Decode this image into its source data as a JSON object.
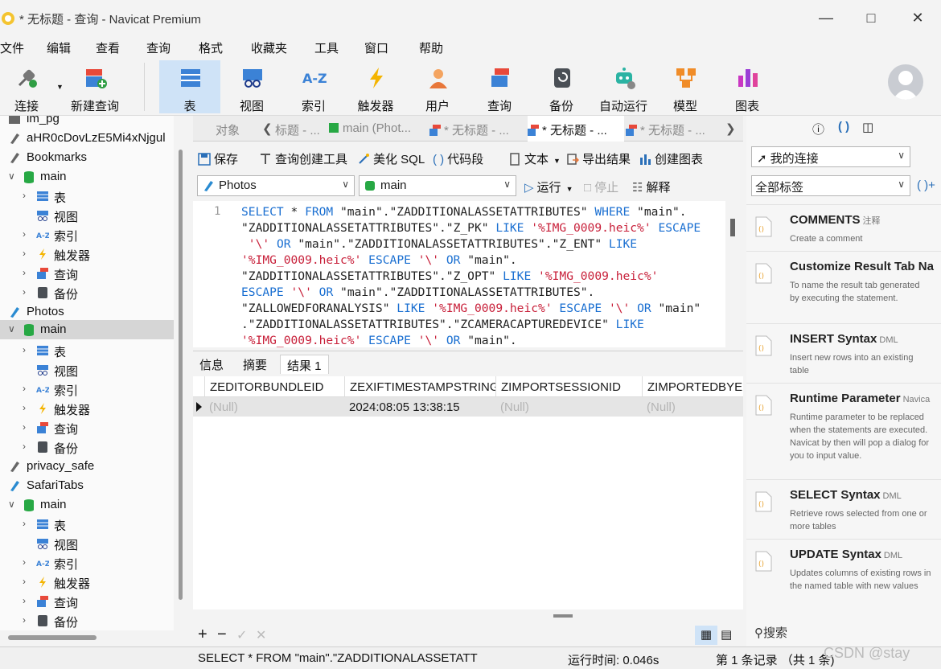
{
  "window": {
    "title": "* 无标题 - 查询 - Navicat Premium"
  },
  "menu": [
    "文件",
    "编辑",
    "查看",
    "查询",
    "格式",
    "收藏夹",
    "工具",
    "窗口",
    "帮助"
  ],
  "toolbar": {
    "connect": "连接",
    "new_query": "新建查询",
    "table": "表",
    "view": "视图",
    "index": "索引",
    "trigger": "触发器",
    "user": "用户",
    "query": "查询",
    "backup": "备份",
    "automation": "自动运行",
    "model": "模型",
    "chart": "图表"
  },
  "sidebar": {
    "im_pg": "im_pg",
    "conn2": "aHR0cDovLzE5Mi4xNjgul",
    "bookmarks": "Bookmarks",
    "photos": "Photos",
    "privacy": "privacy_safe",
    "safaritabs": "SafariTabs",
    "main": "main",
    "table": "表",
    "view": "视图",
    "index": "索引",
    "trigger": "触发器",
    "query": "查询",
    "backup": "备份"
  },
  "tabs": {
    "objects": "对象",
    "t1": "标题 - ...",
    "t2": "main (Phot...",
    "t3": "* 无标题 - ...",
    "t4": "* 无标题 - ...",
    "t5": "* 无标题 - ..."
  },
  "query_toolbar": {
    "save": "保存",
    "builder": "查询创建工具",
    "beautify": "美化 SQL",
    "snippet": "代码段",
    "text": "文本",
    "export": "导出结果",
    "create_chart": "创建图表"
  },
  "selectors": {
    "connection": "Photos",
    "database": "main",
    "run": "运行",
    "stop": "停止",
    "explain": "解释"
  },
  "editor": {
    "line_number": "1",
    "lines": [
      [
        [
          "kw",
          "SELECT"
        ],
        [
          "t",
          " * "
        ],
        [
          "kw",
          "FROM"
        ],
        [
          "t",
          " \"main\".\"ZADDITIONALASSETATTRIBUTES\" "
        ],
        [
          "kw",
          "WHERE"
        ],
        [
          "t",
          " \"main\"."
        ]
      ],
      [
        [
          "t",
          "\"ZADDITIONALASSETATTRIBUTES\".\"Z_PK\" "
        ],
        [
          "kw",
          "LIKE"
        ],
        [
          "t",
          " "
        ],
        [
          "str",
          "'%IMG_0009.heic%'"
        ],
        [
          "t",
          " "
        ],
        [
          "kw",
          "ESCAPE"
        ]
      ],
      [
        [
          "t",
          " "
        ],
        [
          "str",
          "'\\'"
        ],
        [
          "t",
          " "
        ],
        [
          "kw",
          "OR"
        ],
        [
          "t",
          " \"main\".\"ZADDITIONALASSETATTRIBUTES\".\"Z_ENT\" "
        ],
        [
          "kw",
          "LIKE"
        ]
      ],
      [
        [
          "str",
          "'%IMG_0009.heic%'"
        ],
        [
          "t",
          " "
        ],
        [
          "kw",
          "ESCAPE"
        ],
        [
          "t",
          " "
        ],
        [
          "str",
          "'\\'"
        ],
        [
          "t",
          " "
        ],
        [
          "kw",
          "OR"
        ],
        [
          "t",
          " \"main\"."
        ]
      ],
      [
        [
          "t",
          "\"ZADDITIONALASSETATTRIBUTES\".\"Z_OPT\" "
        ],
        [
          "kw",
          "LIKE"
        ],
        [
          "t",
          " "
        ],
        [
          "str",
          "'%IMG_0009.heic%'"
        ]
      ],
      [
        [
          "kw",
          "ESCAPE"
        ],
        [
          "t",
          " "
        ],
        [
          "str",
          "'\\'"
        ],
        [
          "t",
          " "
        ],
        [
          "kw",
          "OR"
        ],
        [
          "t",
          " \"main\".\"ZADDITIONALASSETATTRIBUTES\"."
        ]
      ],
      [
        [
          "t",
          "\"ZALLOWEDFORANALYSIS\" "
        ],
        [
          "kw",
          "LIKE"
        ],
        [
          "t",
          " "
        ],
        [
          "str",
          "'%IMG_0009.heic%'"
        ],
        [
          "t",
          " "
        ],
        [
          "kw",
          "ESCAPE"
        ],
        [
          "t",
          " "
        ],
        [
          "str",
          "'\\'"
        ],
        [
          "t",
          " "
        ],
        [
          "kw",
          "OR"
        ],
        [
          "t",
          " \"main\""
        ]
      ],
      [
        [
          "t",
          ".\"ZADDITIONALASSETATTRIBUTES\".\"ZCAMERACAPTUREDEVICE\" "
        ],
        [
          "kw",
          "LIKE"
        ]
      ],
      [
        [
          "str",
          "'%IMG_0009.heic%'"
        ],
        [
          "t",
          " "
        ],
        [
          "kw",
          "ESCAPE"
        ],
        [
          "t",
          " "
        ],
        [
          "str",
          "'\\'"
        ],
        [
          "t",
          " "
        ],
        [
          "kw",
          "OR"
        ],
        [
          "t",
          " \"main\"."
        ]
      ]
    ]
  },
  "result_tabs": {
    "info": "信息",
    "summary": "摘要",
    "result": "结果 1"
  },
  "grid": {
    "columns": [
      "ZEDITORBUNDLEID",
      "ZEXIFTIMESTAMPSTRING",
      "ZIMPORTSESSIONID",
      "ZIMPORTEDBYE"
    ],
    "row": [
      "(Null)",
      "2024:08:05 13:38:15",
      "(Null)",
      "(Null)"
    ]
  },
  "status": {
    "sql": "SELECT * FROM \"main\".\"ZADDITIONALASSETATT",
    "time": "运行时间: 0.046s",
    "records": "第 1 条记录 （共 1 条)"
  },
  "right_panel": {
    "connection": "我的连接",
    "tags": "全部标签",
    "search": "搜索",
    "snippets": [
      {
        "title": "COMMENTS",
        "tag": "注释",
        "desc": "Create a comment"
      },
      {
        "title": "Customize Result Tab Na",
        "tag": "",
        "desc": "To name the result tab generated by executing the statement."
      },
      {
        "title": "INSERT Syntax",
        "tag": "DML",
        "desc": "Insert new rows into an existing table"
      },
      {
        "title": "Runtime Parameter",
        "tag": "Navica",
        "desc": "Runtime parameter to be replaced when the statements are executed. Navicat by then will pop a dialog for you to input value."
      },
      {
        "title": "SELECT Syntax",
        "tag": "DML",
        "desc": "Retrieve rows selected from one or more tables"
      },
      {
        "title": "UPDATE Syntax",
        "tag": "DML",
        "desc": "Updates columns of existing rows in the named table with new values"
      }
    ]
  },
  "watermark": "CSDN @stay"
}
